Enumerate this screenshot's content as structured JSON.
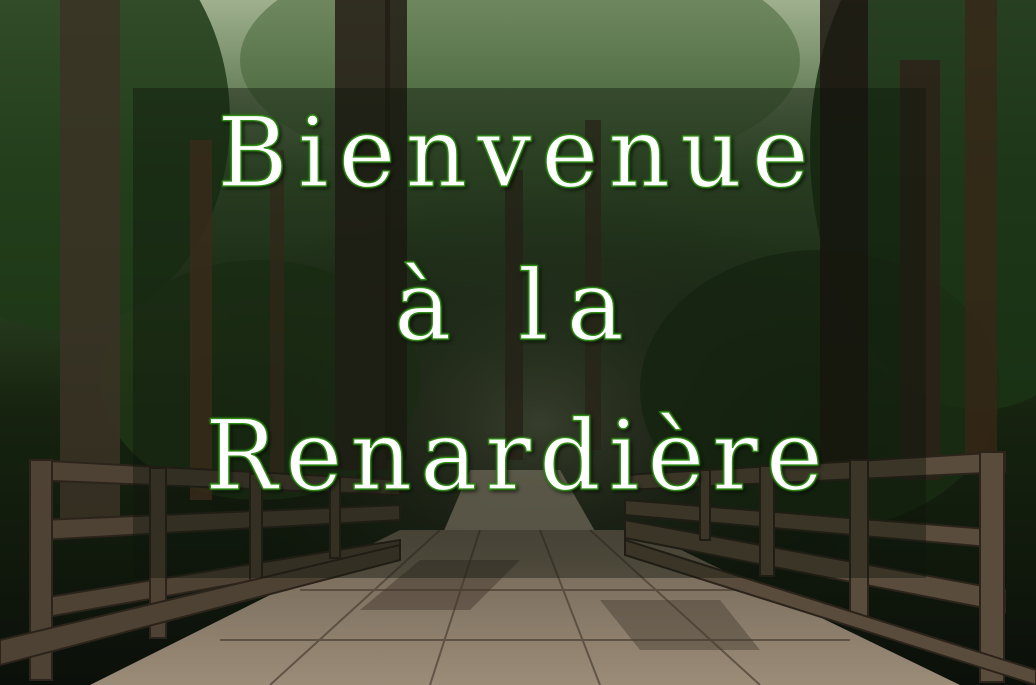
{
  "title": {
    "line1": "Bienvenue",
    "line2": "à la",
    "line3": "Renardière"
  },
  "colors": {
    "text": "#ffffff",
    "text_glow": "#2f8a16",
    "panel": "#0e160c",
    "forest_dark": "#0d140c",
    "forest_green": "#2b4a22",
    "bridge_wood": "#7a6a58",
    "path_light": "#b8a894"
  },
  "scene": {
    "background": "photo of a forest trail with redwood trees leading to a wooden footbridge",
    "overlay": "semi-transparent dark rectangle behind the title"
  }
}
